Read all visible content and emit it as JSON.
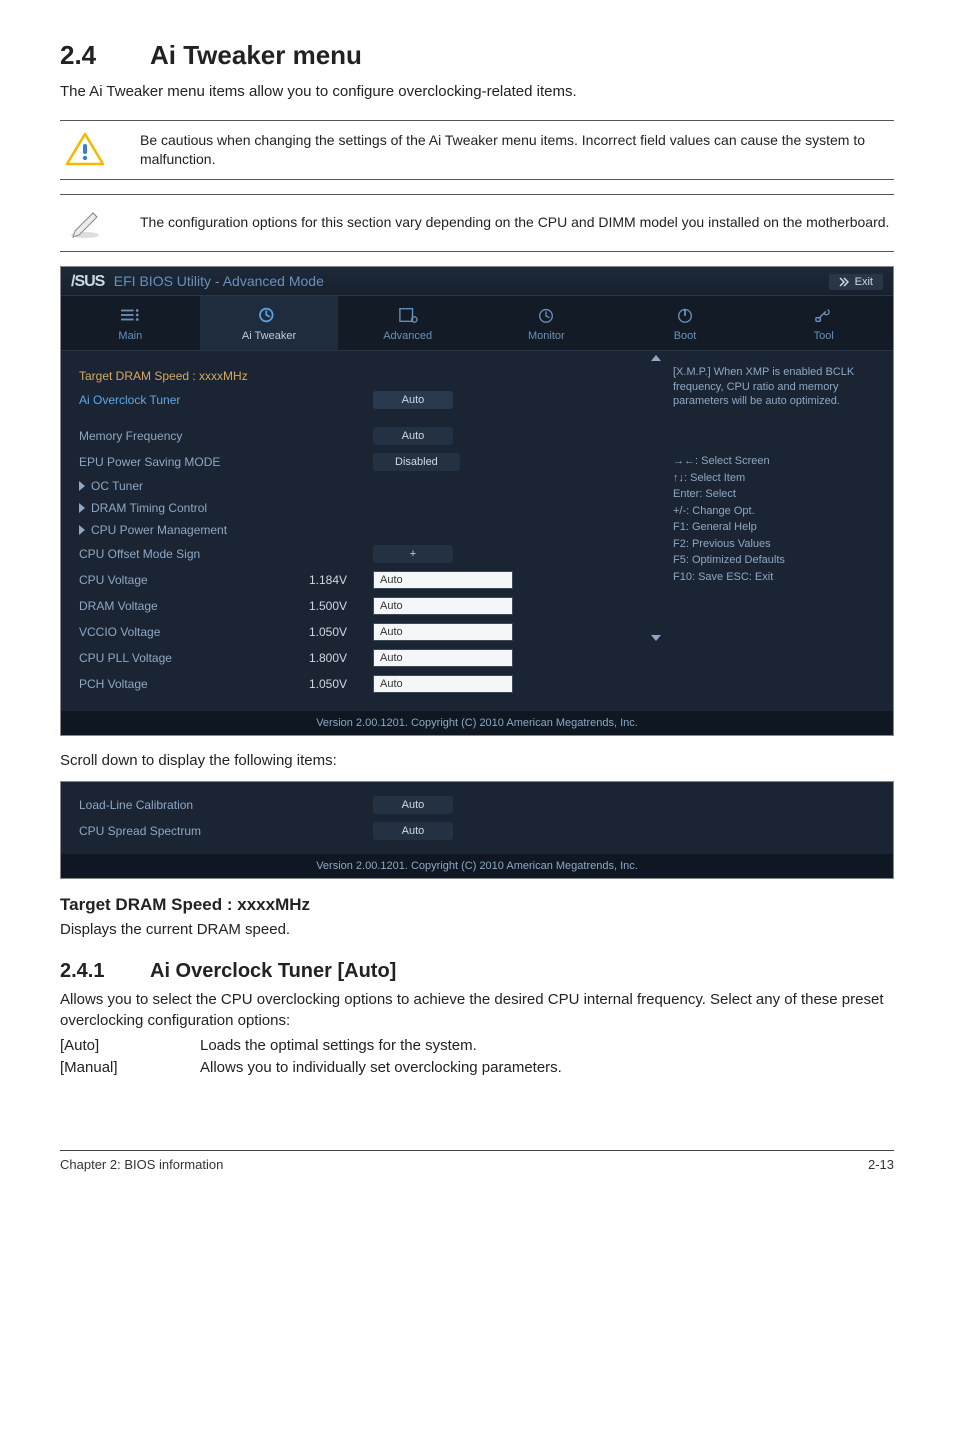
{
  "section": {
    "num": "2.4",
    "title": "Ai Tweaker menu"
  },
  "intro": "The Ai Tweaker menu items allow you to configure overclocking-related items.",
  "note1": "Be cautious when changing the settings of the Ai Tweaker menu items. Incorrect field values can cause the system to malfunction.",
  "note2": "The configuration options for this section vary depending on the CPU and DIMM model you installed on the motherboard.",
  "bios": {
    "logo_text": "/SUS",
    "logo_sub": "EFI BIOS Utility - Advanced Mode",
    "exit": "Exit",
    "tabs": {
      "main": "Main",
      "tweaker": "Ai  Tweaker",
      "advanced": "Advanced",
      "monitor": "Monitor",
      "boot": "Boot",
      "tool": "Tool"
    },
    "rows": {
      "target_dram": "Target DRAM Speed : xxxxMHz",
      "ai_oc_tuner": {
        "label": "Ai Overclock Tuner",
        "value": "Auto"
      },
      "mem_freq": {
        "label": "Memory Frequency",
        "value": "Auto"
      },
      "epu": {
        "label": "EPU Power Saving MODE",
        "value": "Disabled"
      },
      "oc_tuner": "OC Tuner",
      "dram_timing": "DRAM Timing Control",
      "cpu_pm": "CPU Power Management",
      "offset_sign": {
        "label": "CPU Offset Mode Sign",
        "value": "+"
      },
      "cpu_v": {
        "label": "CPU Voltage",
        "num": "1.184V",
        "value": "Auto"
      },
      "dram_v": {
        "label": "DRAM Voltage",
        "num": "1.500V",
        "value": "Auto"
      },
      "vccio_v": {
        "label": "VCCIO Voltage",
        "num": "1.050V",
        "value": "Auto"
      },
      "cpupll_v": {
        "label": "CPU PLL Voltage",
        "num": "1.800V",
        "value": "Auto"
      },
      "pch_v": {
        "label": "PCH Voltage",
        "num": "1.050V",
        "value": "Auto"
      }
    },
    "help_desc": "[X.M.P.] When XMP is enabled BCLK frequency, CPU ratio and memory parameters will be auto optimized.",
    "help_keys": {
      "l1": "→←: Select Screen",
      "l2": "↑↓: Select Item",
      "l3": "Enter: Select",
      "l4": "+/-: Change Opt.",
      "l5": "F1: General Help",
      "l6": "F2: Previous Values",
      "l7": "F5: Optimized Defaults",
      "l8": "F10: Save   ESC: Exit"
    },
    "footer": "Version 2.00.1201.   Copyright  (C)  2010  American  Megatrends, Inc."
  },
  "scroll_caption": "Scroll down to display the following items:",
  "bios2": {
    "rows": {
      "llc": {
        "label": "Load-Line Calibration",
        "value": "Auto"
      },
      "css": {
        "label": "CPU Spread Spectrum",
        "value": "Auto"
      }
    }
  },
  "subhead": "Target DRAM Speed : xxxxMHz",
  "subhead_body": "Displays the current DRAM speed.",
  "subsec": {
    "num": "2.4.1",
    "title": "Ai Overclock Tuner [Auto]"
  },
  "subsec_body": "Allows you to select the CPU overclocking options to achieve the desired CPU internal frequency. Select any of these preset overclocking configuration options:",
  "opts": {
    "auto": {
      "k": "[Auto]",
      "v": "Loads the optimal settings for the system."
    },
    "manual": {
      "k": "[Manual]",
      "v": "Allows you to individually set overclocking parameters."
    }
  },
  "footer": {
    "left": "Chapter 2: BIOS information",
    "right": "2-13"
  }
}
